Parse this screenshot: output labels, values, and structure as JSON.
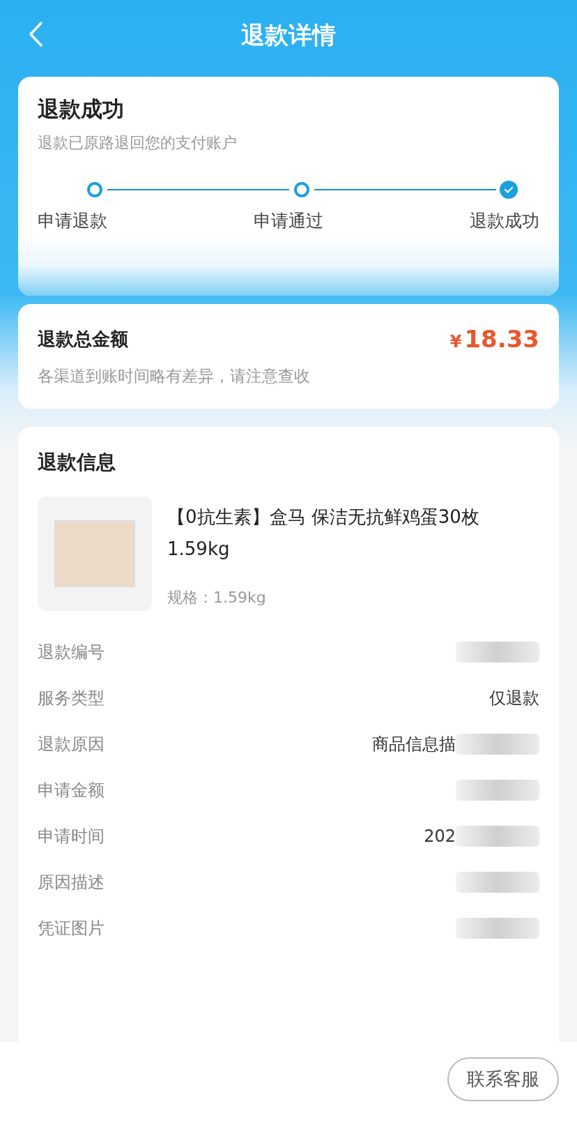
{
  "header": {
    "title": "退款详情"
  },
  "status_card": {
    "title": "退款成功",
    "subtitle": "退款已原路退回您的支付账户",
    "details_redacted": true,
    "steps": [
      {
        "label": "申请退款",
        "selected": false
      },
      {
        "label": "申请通过",
        "selected": false
      },
      {
        "label": "退款成功",
        "selected": true
      }
    ]
  },
  "amount_card": {
    "label": "退款总金额",
    "currency": "¥",
    "amount": "18.33",
    "note": "各渠道到账时间略有差异，请注意查收"
  },
  "info_card": {
    "title": "退款信息",
    "product": {
      "name": "【0抗生素】盒马 保洁无抗鲜鸡蛋30枚 1.59kg",
      "spec": "规格：1.59kg"
    },
    "rows": [
      {
        "label": "退款编号",
        "redacted": true
      },
      {
        "label": "服务类型",
        "value": "仅退款",
        "redacted": false
      },
      {
        "label": "退款原因",
        "value": "商品信息描",
        "redacted": true
      },
      {
        "label": "申请金额",
        "redacted": true
      },
      {
        "label": "申请时间",
        "value": "202",
        "redacted": true
      },
      {
        "label": "原因描述",
        "redacted": true
      },
      {
        "label": "凭证图片",
        "redacted": true
      }
    ]
  },
  "footer": {
    "button": "联系客服"
  }
}
